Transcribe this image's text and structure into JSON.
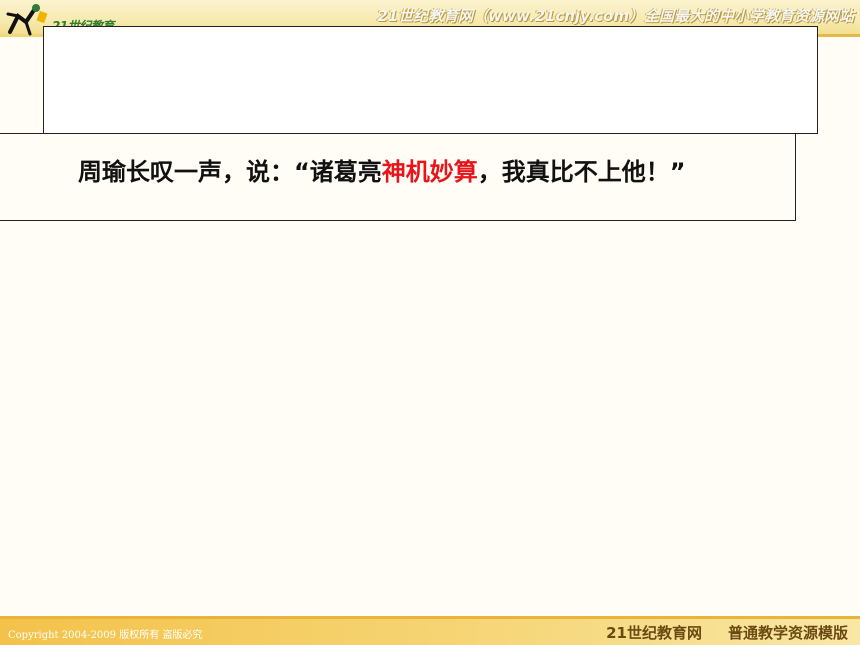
{
  "header": {
    "logo_text": "21世纪教育",
    "slogan": "21世纪教育网（www.21cnjy.com）全国最大的中小学教育资源网站"
  },
  "slide": {
    "title": "",
    "text_before": "周瑜长叹一声，说：“诸葛亮",
    "text_highlight": "神机妙算",
    "text_after": "，我真比不上他！”"
  },
  "footer": {
    "copyright": "Copyright 2004-2009 版权所有 盗版必究",
    "site_name": "21世纪教育网",
    "template_name": "普通教学资源模版"
  },
  "colors": {
    "highlight": "#e8141b",
    "banner": "#f7e9ae",
    "footer": "#f3c24a"
  }
}
